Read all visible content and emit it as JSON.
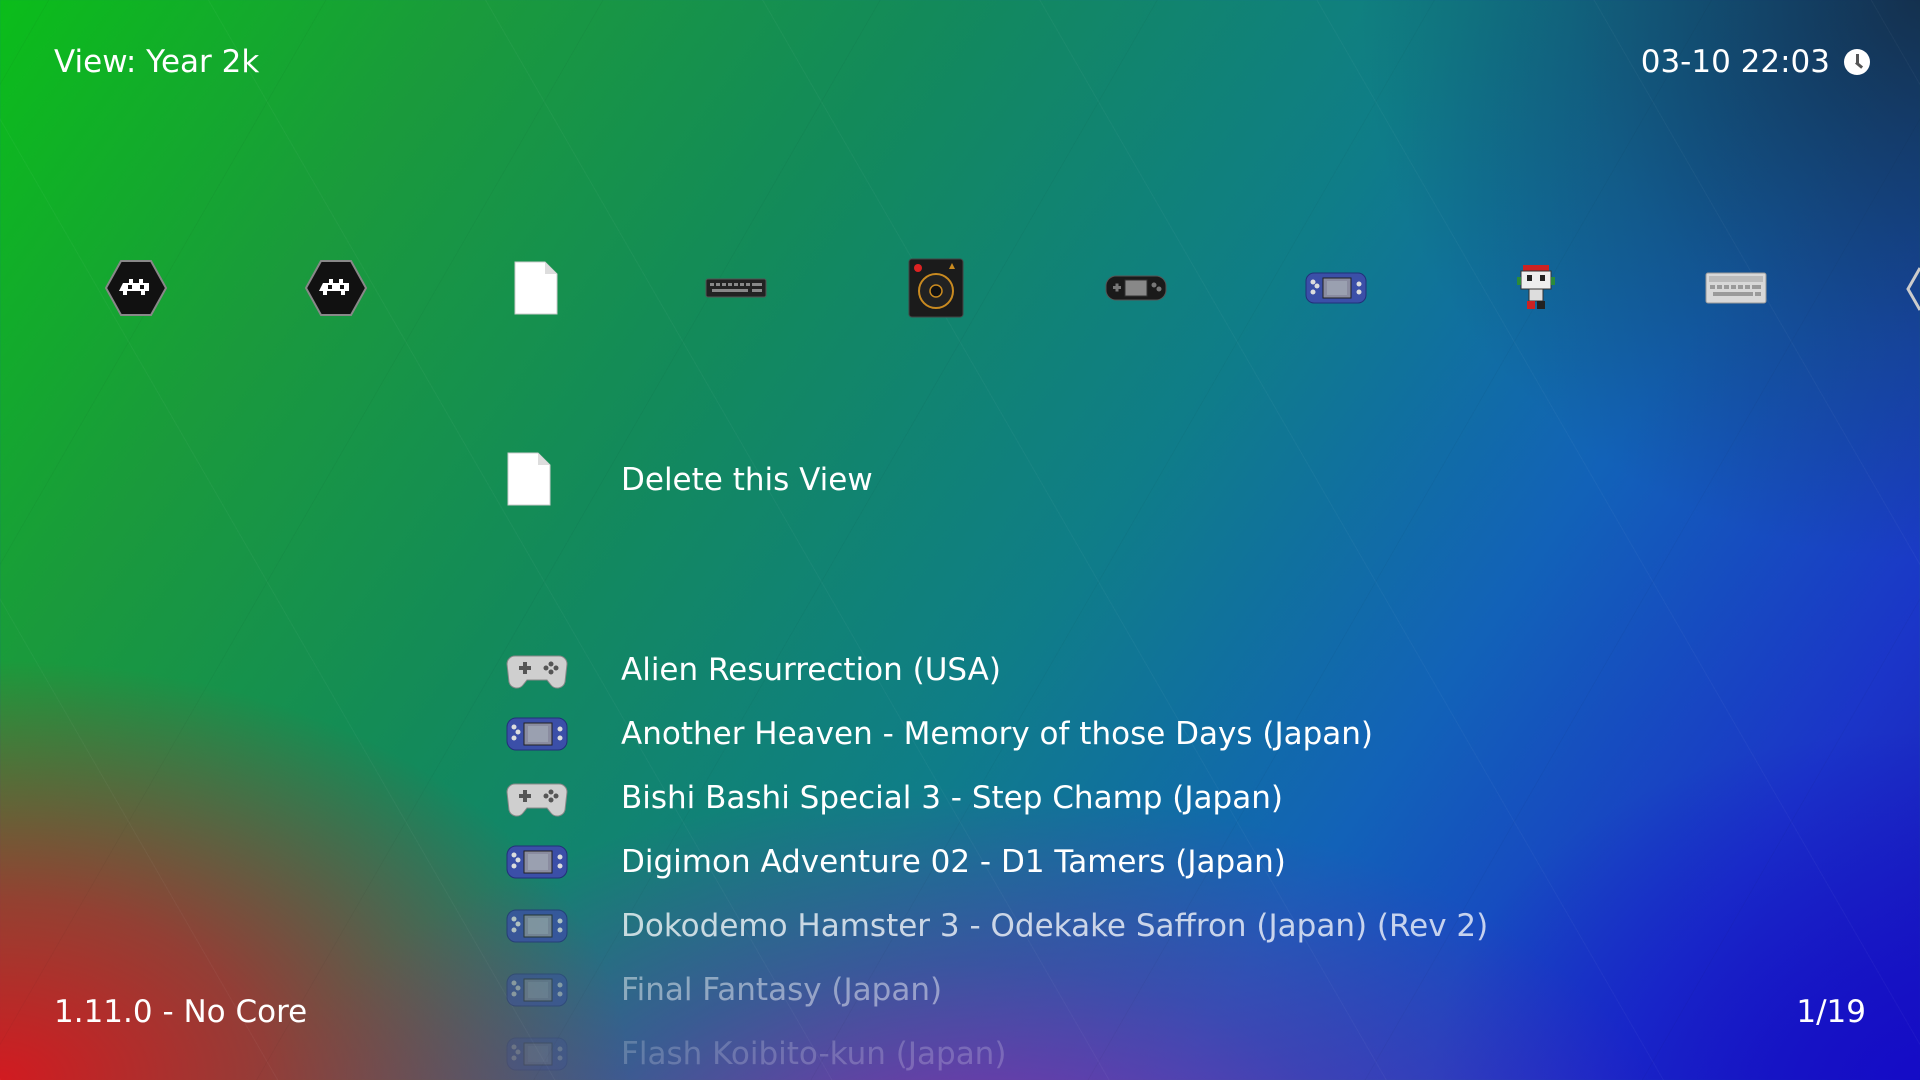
{
  "header": {
    "title": "View: Year 2k",
    "datetime": "03-10 22:03",
    "clock_icon": "clock-icon"
  },
  "tabs": [
    {
      "icon": "retroarch-main-icon"
    },
    {
      "icon": "retroarch-settings-icon"
    },
    {
      "icon": "file-icon"
    },
    {
      "icon": "keyboard-computer-icon"
    },
    {
      "icon": "disc-console-icon"
    },
    {
      "icon": "handheld-console-icon"
    },
    {
      "icon": "wonderswan-icon"
    },
    {
      "icon": "character-sprite-icon"
    },
    {
      "icon": "computer-keyboard-icon"
    }
  ],
  "menu_entry": {
    "icon": "file-icon",
    "label": "Delete this View"
  },
  "list": {
    "items": [
      {
        "label": "Alien Resurrection (USA)",
        "icon": "gamepad-icon"
      },
      {
        "label": "Another Heaven - Memory of those Days (Japan)",
        "icon": "wonderswan-icon"
      },
      {
        "label": "Bishi Bashi Special 3 - Step Champ (Japan)",
        "icon": "gamepad-icon"
      },
      {
        "label": "Digimon Adventure 02 - D1 Tamers (Japan)",
        "icon": "wonderswan-icon"
      },
      {
        "label": "Dokodemo Hamster 3 - Odekake Saffron (Japan) (Rev 2)",
        "icon": "wonderswan-icon"
      },
      {
        "label": "Final Fantasy (Japan)",
        "icon": "wonderswan-icon"
      },
      {
        "label": "Flash Koibito-kun (Japan)",
        "icon": "wonderswan-icon"
      }
    ]
  },
  "footer": {
    "version": "1.11.0 - No Core",
    "position": "1/19"
  }
}
